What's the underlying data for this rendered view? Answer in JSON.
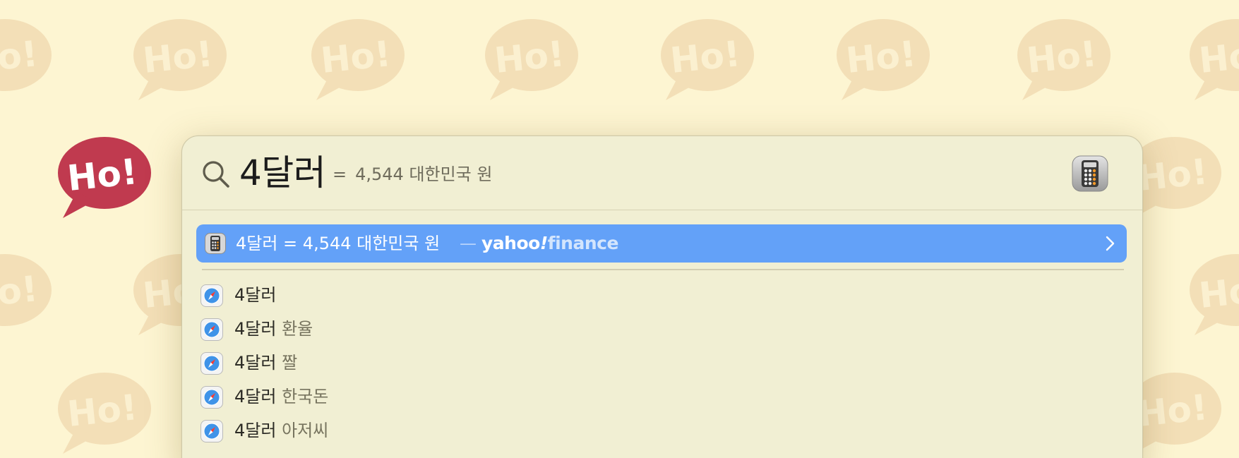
{
  "search": {
    "query": "4달러",
    "inline_equals": "=",
    "inline_result": "4,544 대한민국 원"
  },
  "top_hit": {
    "text": "4달러 = 4,544 대한민국 원",
    "separator": "—",
    "source_brand_yahoo": "yahoo",
    "source_brand_bang": "!",
    "source_brand_finance": "finance"
  },
  "suggestions": [
    {
      "main": "4달러",
      "extra": ""
    },
    {
      "main": "4달러",
      "extra": " 환율"
    },
    {
      "main": "4달러",
      "extra": " 짤"
    },
    {
      "main": "4달러",
      "extra": " 한국돈"
    },
    {
      "main": "4달러",
      "extra": " 아저씨"
    }
  ],
  "wallpaper": {
    "bubble_text": "Ho!",
    "accent_bubble_color": "#c03a4f",
    "faded_bubble_color": "#f3dfb7"
  },
  "colors": {
    "background": "#fdf5d2",
    "panel": "#f1efd3",
    "selection": "#63a1f8"
  },
  "icons": {
    "search": "magnifying-glass",
    "app": "calculator",
    "result": "calculator",
    "suggestion": "safari-compass",
    "disclosure": "chevron-right"
  }
}
